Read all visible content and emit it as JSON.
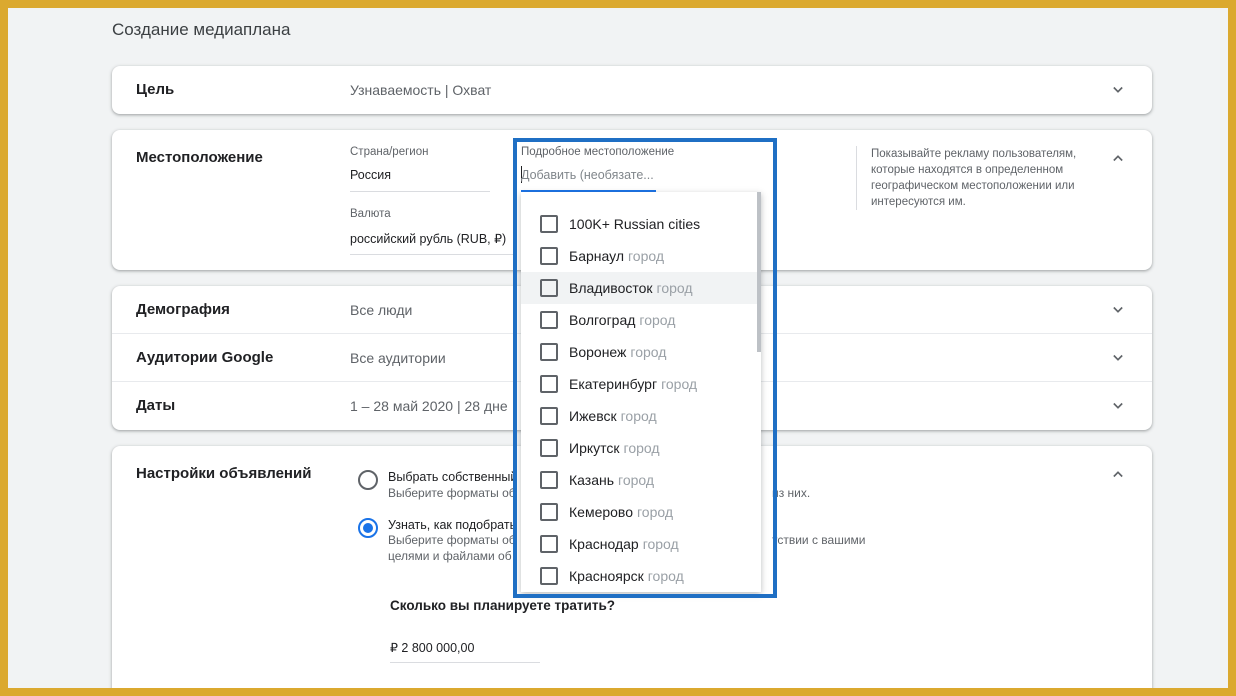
{
  "page": {
    "title": "Создание медиаплана"
  },
  "goal": {
    "label": "Цель",
    "value": "Узнаваемость | Охват"
  },
  "location": {
    "label": "Местоположение",
    "country_label": "Страна/регион",
    "country_value": "Россия",
    "currency_label": "Валюта",
    "currency_value": "российский рубль (RUB, ₽)",
    "detail_label": "Подробное местоположение",
    "detail_placeholder": "Добавить (необязате...",
    "help": "Показывайте рекламу пользователям, которые находятся в определенном географическом местоположении или интересуются им."
  },
  "dropdown": {
    "items": [
      {
        "name": "100K+ Russian cities",
        "type": ""
      },
      {
        "name": "Барнаул",
        "type": "город"
      },
      {
        "name": "Владивосток",
        "type": "город"
      },
      {
        "name": "Волгоград",
        "type": "город"
      },
      {
        "name": "Воронеж",
        "type": "город"
      },
      {
        "name": "Екатеринбург",
        "type": "город"
      },
      {
        "name": "Ижевск",
        "type": "город"
      },
      {
        "name": "Иркутск",
        "type": "город"
      },
      {
        "name": "Казань",
        "type": "город"
      },
      {
        "name": "Кемерово",
        "type": "город"
      },
      {
        "name": "Краснодар",
        "type": "город"
      },
      {
        "name": "Красноярск",
        "type": "город"
      }
    ]
  },
  "demography": {
    "label": "Демография",
    "value": "Все люди"
  },
  "audiences": {
    "label": "Аудитории Google",
    "value": "Все аудитории"
  },
  "dates": {
    "label": "Даты",
    "value": "1 – 28 май 2020 | 28 дне"
  },
  "ads": {
    "label": "Настройки объявлений",
    "opt1_title": "Выбрать собственный",
    "opt1_desc": "Выберите форматы об",
    "opt1_desc_tail": "из них.",
    "opt2_title": "Узнать, как подобрать",
    "opt2_desc_line1": "Выберите форматы об",
    "opt2_desc_line1_tail": "тствии с вашими",
    "opt2_desc_line2": "целями и файлами об",
    "budget_question": "Сколько вы планируете тратить?",
    "budget_value": "₽ 2 800 000,00"
  }
}
